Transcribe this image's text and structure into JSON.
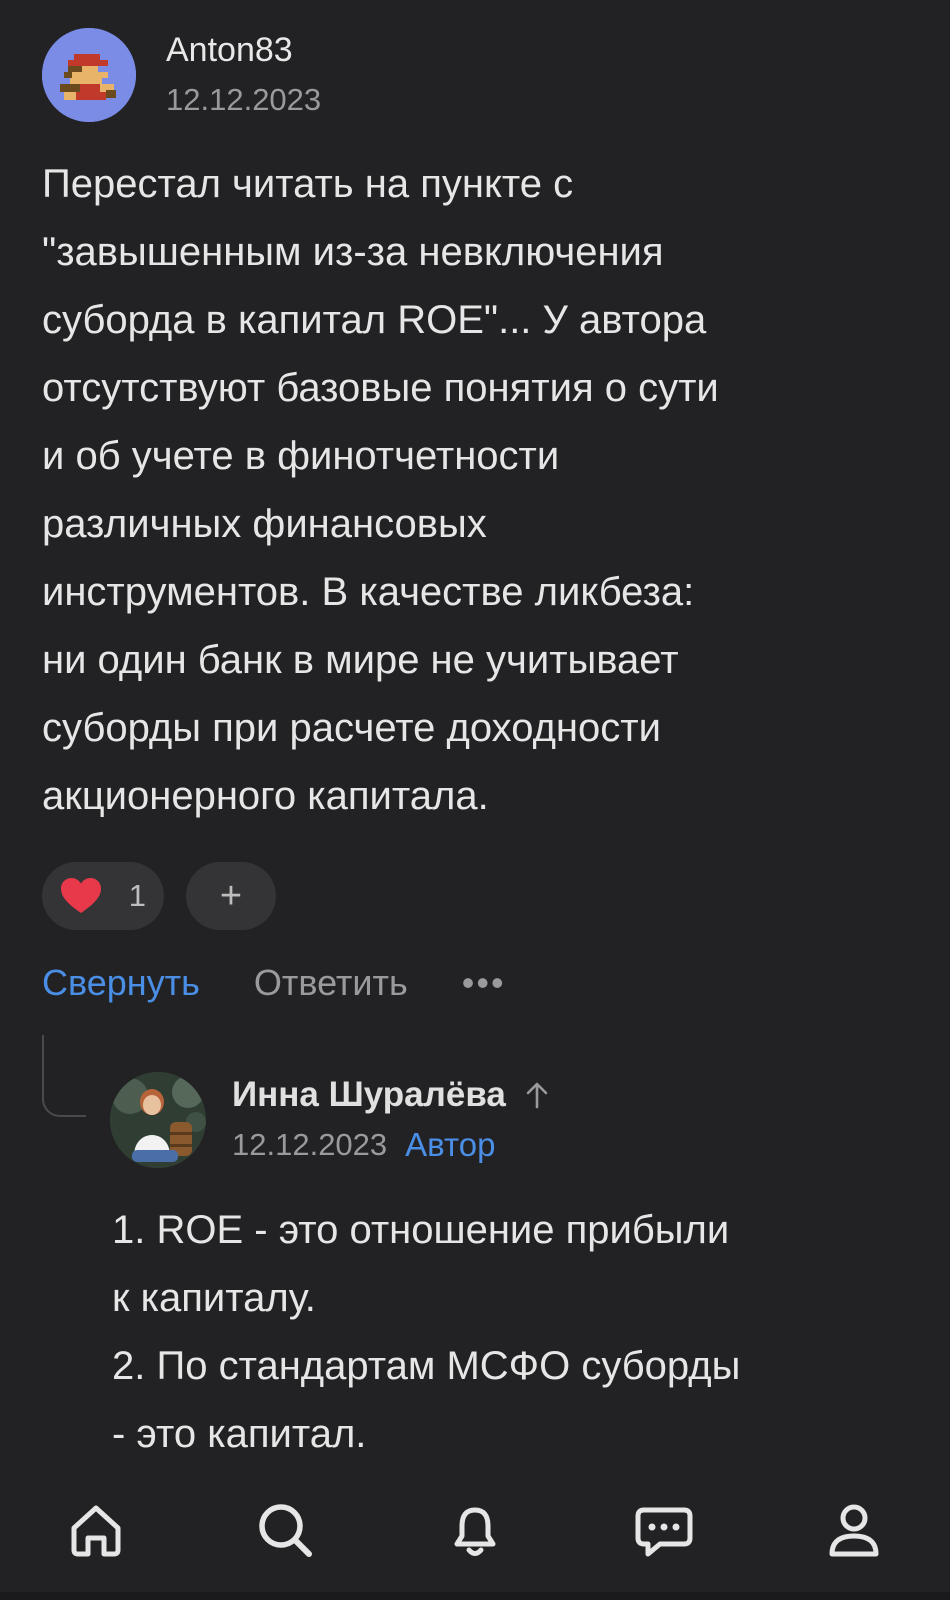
{
  "comment": {
    "username": "Anton83",
    "date": "12.12.2023",
    "text": "Перестал читать на пункте с\n\"завышенным из-за невключения\nсуборда в капитал ROE\"... У автора\nотсутствуют базовые понятия о сути\nи об учете в финотчетности\nразличных финансовых\nинструментов. В качестве ликбеза:\nни один банк в мире не учитывает\nсуборды при расчете доходности\nакционерного капитала.",
    "likes": "1",
    "add_reaction": "+"
  },
  "actions": {
    "collapse": "Свернуть",
    "reply": "Ответить",
    "more": "•••"
  },
  "reply": {
    "username": "Инна Шуралёва",
    "date": "12.12.2023",
    "badge": "Автор",
    "text": "1. ROE - это отношение прибыли\nк капиталу.\n2. По стандартам МСФО суборды\n- это капитал."
  },
  "nav": {
    "icons": [
      "home-icon",
      "search-icon",
      "bell-icon",
      "chat-icon",
      "profile-icon"
    ]
  },
  "colors": {
    "background": "#222224",
    "accent": "#4a8ee6",
    "muted": "#9a9a9c",
    "heart": "#e8394a"
  }
}
